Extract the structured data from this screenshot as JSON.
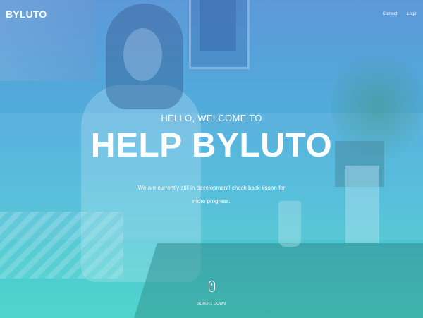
{
  "header": {
    "brand": "BYLUTO",
    "nav": [
      {
        "label": "Contact"
      },
      {
        "label": "Login"
      }
    ]
  },
  "hero": {
    "welcome": "HELLO, WELCOME TO",
    "headline": "HELP BYLUTO",
    "subtitle": "We are currently still in development! check back #soon for more progress."
  },
  "scroll": {
    "label": "SCROLL DOWN",
    "icon": "mouse-icon"
  },
  "colors": {
    "overlay_top": "#5d9bd8",
    "overlay_bottom": "#57d4cf",
    "text": "#ffffff"
  }
}
